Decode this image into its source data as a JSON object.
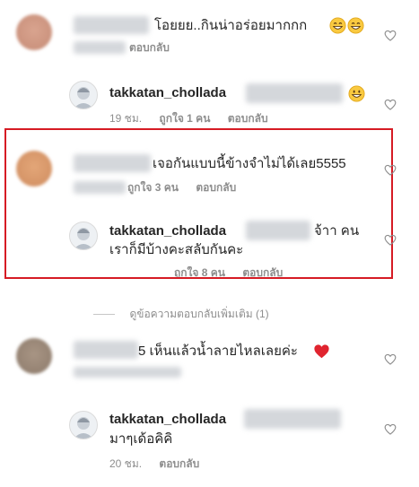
{
  "comments": [
    {
      "text": "โอยยย..กินน่าอร่อยมากกก",
      "emojis": "grinning-face-with-smiling-eyes ×2",
      "reply_label": "ตอบกลับ"
    },
    {
      "username": "takkatan_chollada",
      "time": "19 ชม.",
      "likes": "ถูกใจ 1 คน",
      "reply_label": "ตอบกลับ",
      "emoji": "grinning-face"
    },
    {
      "text": "เจอกันแบบนี้ข้างจำไม่ได้เลย5555",
      "likes": "ถูกใจ 3 คน",
      "reply_label": "ตอบกลับ"
    },
    {
      "username": "takkatan_chollada",
      "text_suffix": "จ้าา คน",
      "text_line2": "เราก็มีบ้างคะสลับกันคะ",
      "likes": "ถูกใจ 8 คน",
      "reply_label": "ตอบกลับ"
    },
    {
      "text": "5 เห็นแล้วน้ำลายไหลเลยค่ะ",
      "emoji": "red-heart"
    },
    {
      "username": "takkatan_chollada",
      "text_line2": "มาๆเด้อคิคิ",
      "time": "20 ชม.",
      "reply_label": "ตอบกลับ"
    }
  ],
  "view_more_replies": "ดูข้อความตอบกลับเพิ่มเติม (1)",
  "icons": {
    "like": "heart-outline-icon"
  },
  "colors": {
    "highlight_border": "#d61b24",
    "secondary_text": "#8e8e8e",
    "primary_text": "#262626"
  }
}
